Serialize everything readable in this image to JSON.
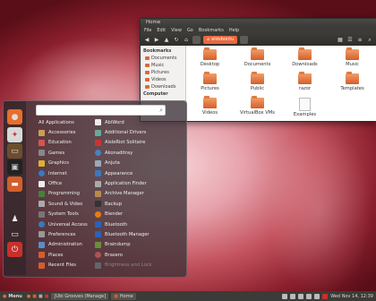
{
  "file_manager": {
    "title": "Home",
    "menu": [
      "File",
      "Edit",
      "View",
      "Go",
      "Bookmarks",
      "Help"
    ],
    "breadcrumb": "eldvbontu",
    "sidebar": {
      "bookmarks_heading": "Bookmarks",
      "bookmarks": [
        "Documents",
        "Music",
        "Pictures",
        "Videos",
        "Downloads"
      ],
      "computer_heading": "Computer"
    },
    "items": [
      "Desktop",
      "Documents",
      "Downloads",
      "Music",
      "Pictures",
      "Public",
      "razor",
      "Templates",
      "Videos",
      "VirtualBox VMs",
      "Examples"
    ]
  },
  "dash": {
    "categories": [
      "All Applications",
      "Accessories",
      "Education",
      "Games",
      "Graphics",
      "Internet",
      "Office",
      "Programming",
      "Sound & Video",
      "System Tools",
      "Universal Access",
      "Preferences",
      "Administration",
      "Places",
      "Recent Files"
    ],
    "apps": [
      "AbiWord",
      "Additional Drivers",
      "AisleRiot Solitaire",
      "Akonaditray",
      "Anjuta",
      "Appearance",
      "Application Finder",
      "Archive Manager",
      "Backup",
      "Blender",
      "Bluetooth",
      "Bluetooth Manager",
      "Braindump",
      "Brasero",
      "Brightness and Lock"
    ]
  },
  "panel": {
    "menu_label": "Menu",
    "tasks": [
      "[Ubi Grooves (Manage]",
      "Home"
    ],
    "clock": "Wed Nov 14, 12:39"
  },
  "colors": {
    "accent": "#e8683f",
    "panel": "#3c3b37",
    "folder": "#d45e2b"
  }
}
